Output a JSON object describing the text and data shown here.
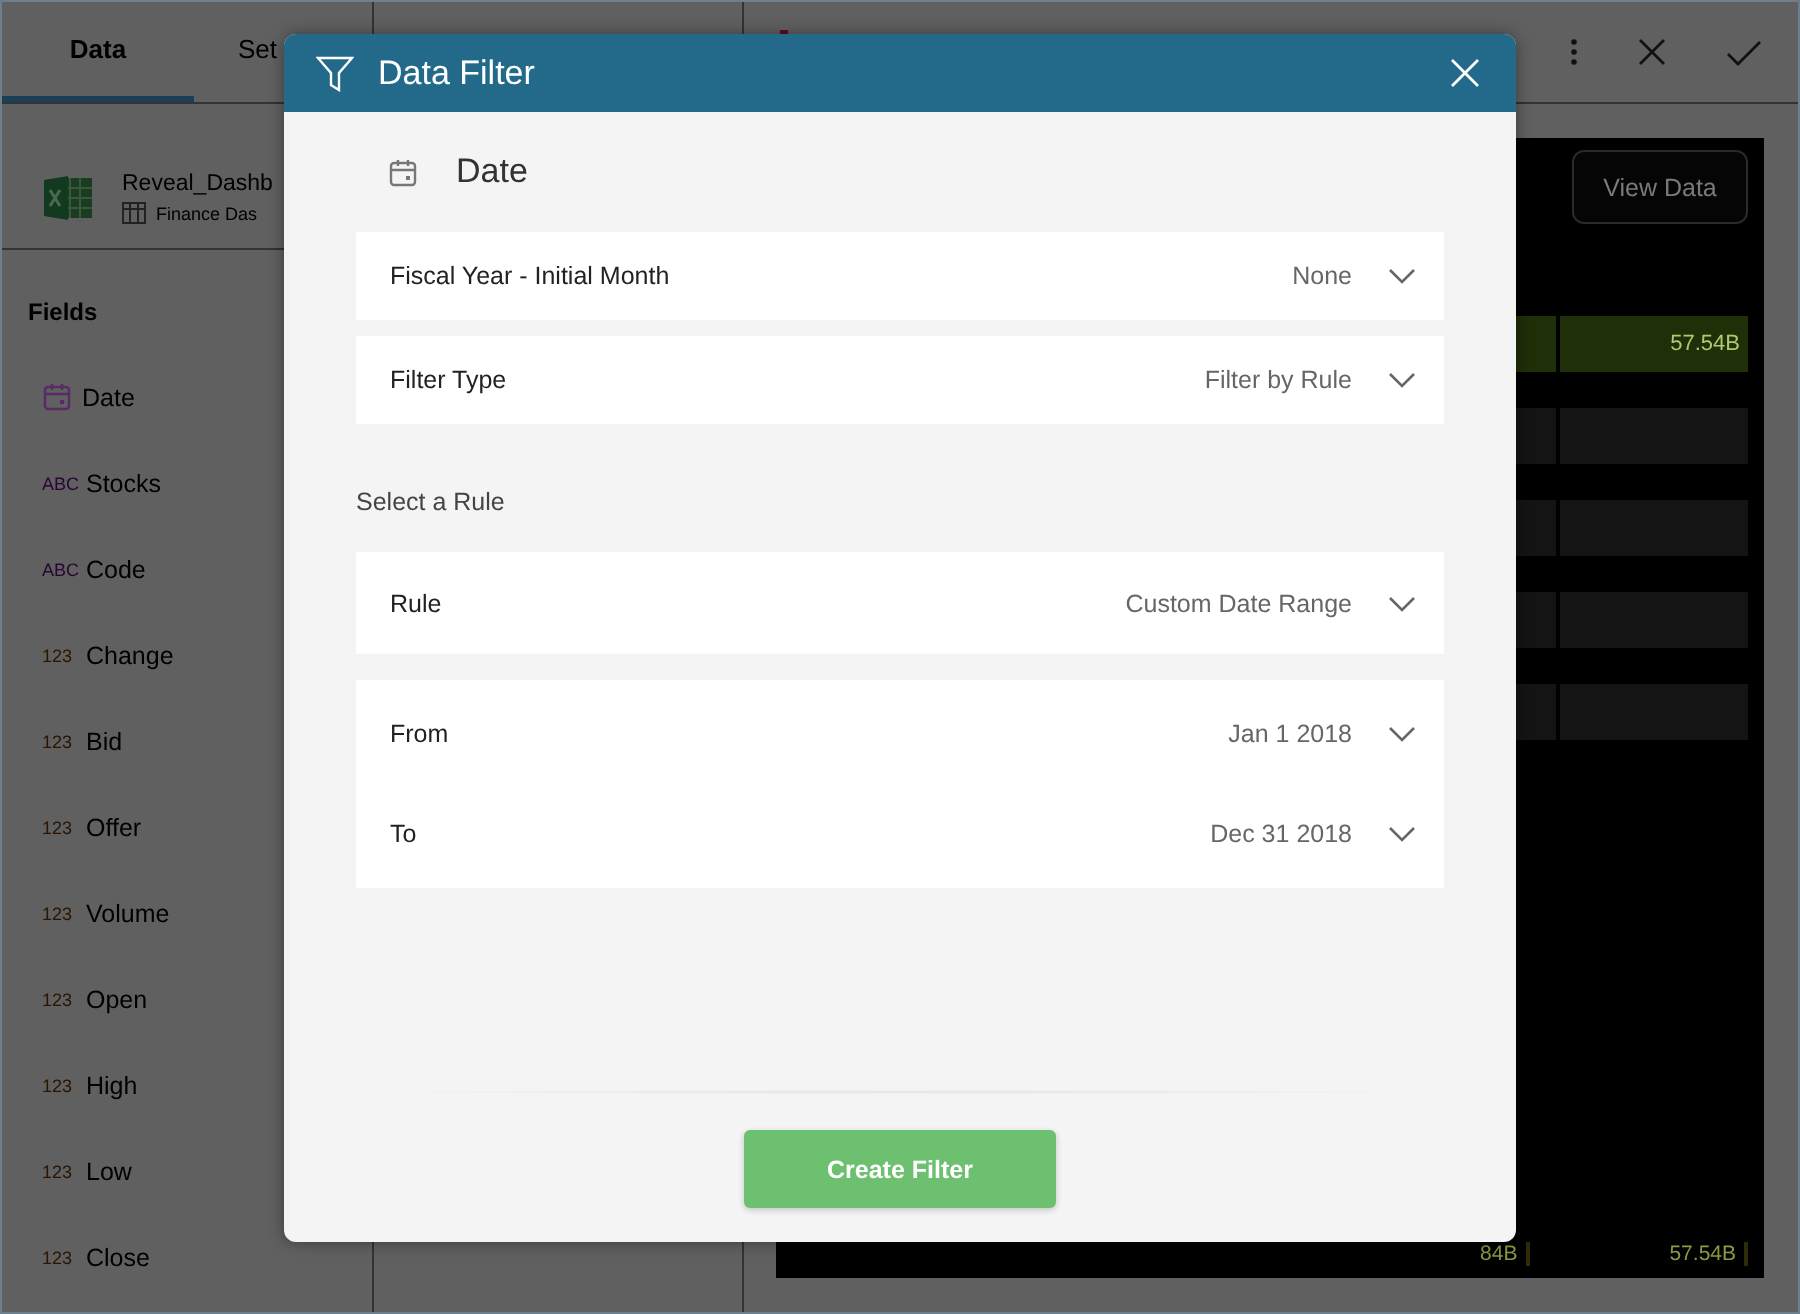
{
  "sidebar": {
    "tabs": [
      {
        "label": "Data",
        "selected": true
      },
      {
        "label": "Set",
        "selected": false
      }
    ],
    "source": {
      "name": "Reveal_Dashb",
      "sheet": "Finance Das"
    },
    "fields_heading": "Fields",
    "fields": [
      {
        "kind": "date",
        "name": "Date"
      },
      {
        "kind": "text",
        "badge": "ABC",
        "name": "Stocks"
      },
      {
        "kind": "text",
        "badge": "ABC",
        "name": "Code"
      },
      {
        "kind": "number",
        "badge": "123",
        "name": "Change"
      },
      {
        "kind": "number",
        "badge": "123",
        "name": "Bid"
      },
      {
        "kind": "number",
        "badge": "123",
        "name": "Offer"
      },
      {
        "kind": "number",
        "badge": "123",
        "name": "Volume"
      },
      {
        "kind": "number",
        "badge": "123",
        "name": "Open"
      },
      {
        "kind": "number",
        "badge": "123",
        "name": "High"
      },
      {
        "kind": "number",
        "badge": "123",
        "name": "Low"
      },
      {
        "kind": "number",
        "badge": "123",
        "name": "Close"
      }
    ]
  },
  "preview": {
    "view_data_button": "View Data",
    "highlight_value": "57.54B",
    "footer_values": [
      "84B",
      "57.54B"
    ]
  },
  "dialog": {
    "title": "Data Filter",
    "field": "Date",
    "settings": [
      {
        "label": "Fiscal Year - Initial Month",
        "value": "None"
      },
      {
        "label": "Filter Type",
        "value": "Filter by Rule"
      }
    ],
    "rule_heading": "Select a Rule",
    "rule": {
      "label": "Rule",
      "value": "Custom Date Range"
    },
    "range": [
      {
        "label": "From",
        "value": "Jan 1 2018"
      },
      {
        "label": "To",
        "value": "Dec 31 2018"
      }
    ],
    "submit_button": "Create Filter"
  }
}
